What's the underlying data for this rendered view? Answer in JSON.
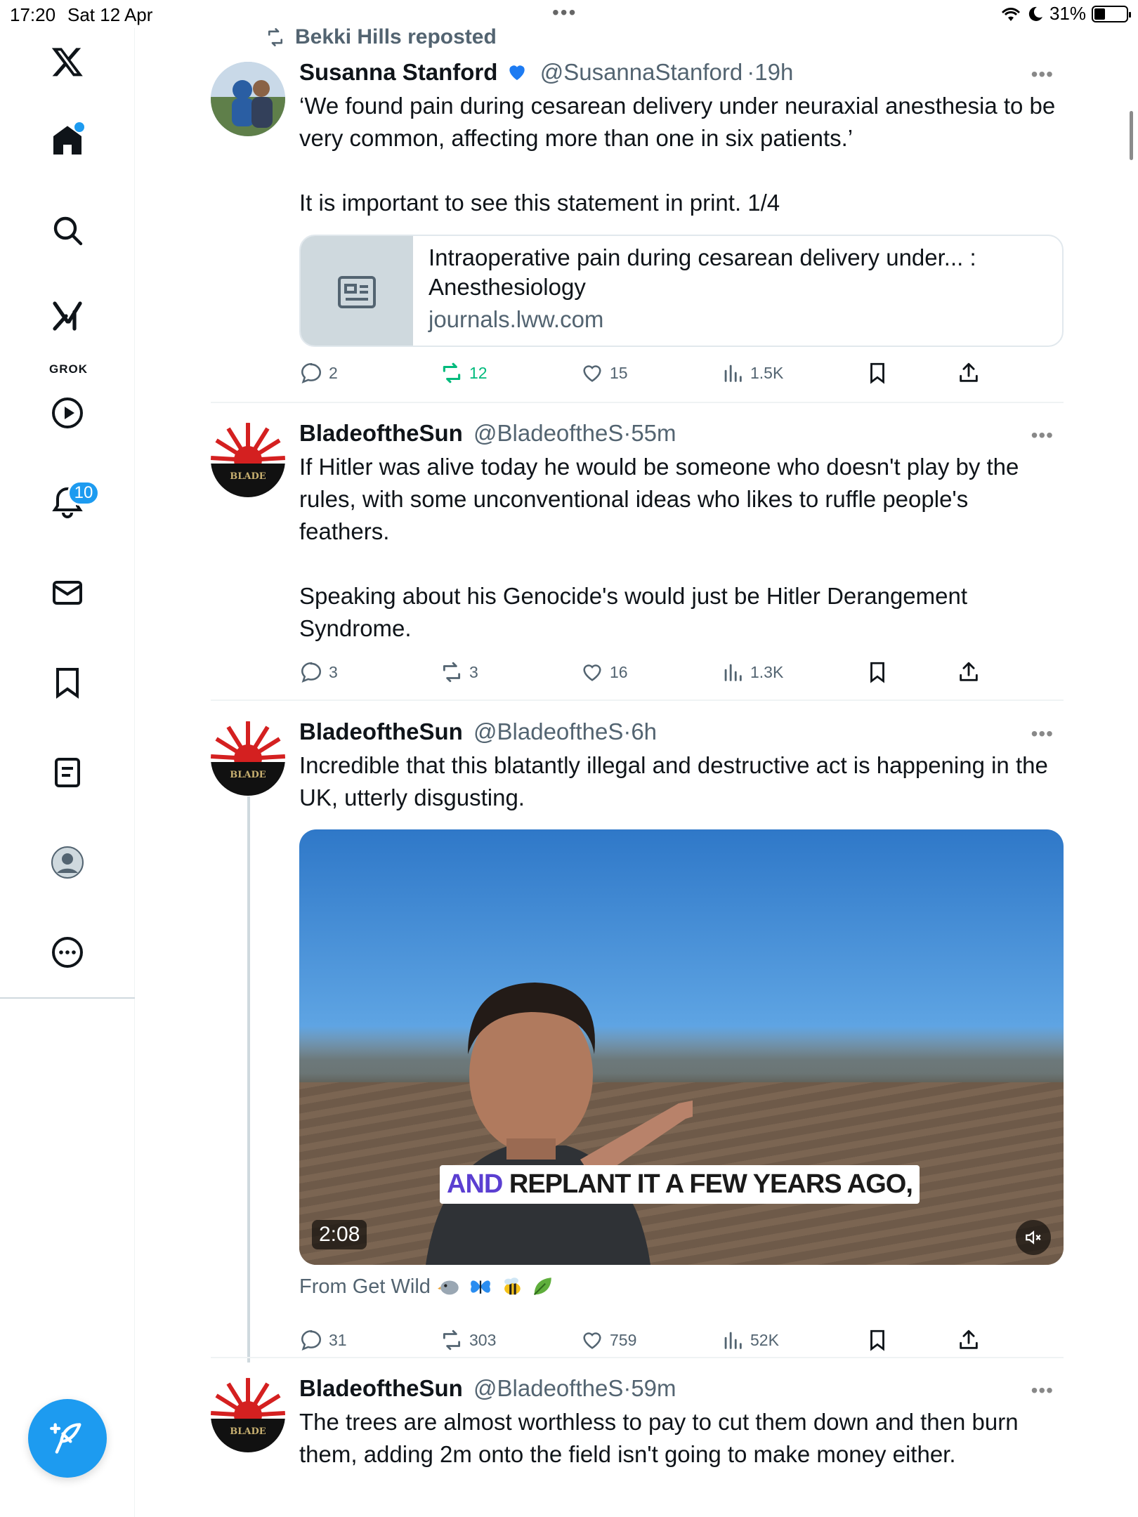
{
  "status_bar": {
    "time": "17:20",
    "date": "Sat 12 Apr",
    "battery": "31%",
    "battery_level": 0.31
  },
  "sidebar": {
    "items": [
      "x-logo",
      "home",
      "search",
      "grok",
      "video",
      "notifications",
      "messages",
      "bookmarks",
      "lists",
      "profile",
      "more"
    ],
    "grok_label": "GROK",
    "notification_count": "10"
  },
  "colors": {
    "accent": "#1d9bf0",
    "repost_green": "#00ba7c",
    "muted": "#536471"
  },
  "tweets": [
    {
      "repost_label": "Bekki Hills reposted",
      "name": "Susanna Stanford",
      "handle": "@SusannaStanford",
      "time": "19h",
      "text": "‘We found pain during cesarean delivery under neuraxial anesthesia to be very common, affecting more than one in six patients.’\n\nIt is important to see this statement in print. 1/4",
      "card": {
        "title": "Intraoperative pain during cesarean delivery under... : Anesthesiology",
        "domain": "journals.lww.com"
      },
      "replies": "2",
      "reposts": "12",
      "likes": "15",
      "views": "1.5K"
    },
    {
      "name": "BladeoftheSun",
      "handle": "@BladeoftheS",
      "time": "55m",
      "text": "If Hitler was alive today he would be someone who doesn't play by the rules, with some unconventional ideas who likes to ruffle people's feathers.\n\nSpeaking about his Genocide's would just be Hitler Derangement Syndrome.",
      "replies": "3",
      "reposts": "3",
      "likes": "16",
      "views": "1.3K"
    },
    {
      "name": "BladeoftheSun",
      "handle": "@BladeoftheS",
      "time": "6h",
      "text": "Incredible that this blatantly illegal and destructive act is happening in the UK, utterly disgusting.",
      "video": {
        "caption_highlight": "AND",
        "caption_rest": " REPLANT IT A FEW YEARS AGO,",
        "duration": "2:08"
      },
      "from": "From Get Wild",
      "replies": "31",
      "reposts": "303",
      "likes": "759",
      "views": "52K"
    },
    {
      "name": "BladeoftheSun",
      "handle": "@BladeoftheS",
      "time": "59m",
      "text": "The trees are almost worthless to pay to cut them down and then burn them, adding 2m onto the field isn't going to make money either."
    }
  ]
}
